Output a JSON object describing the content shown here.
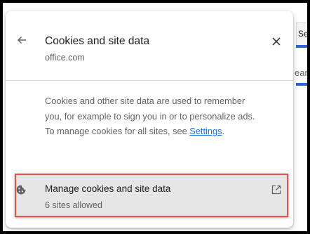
{
  "background": {
    "tab_text": "Se",
    "page_text": "ear",
    "accent_color": "#2b63d9"
  },
  "popup": {
    "back_icon": "arrow-back-icon",
    "title": "Cookies and site data",
    "subtitle": "office.com",
    "close_icon": "close-icon",
    "description_text": "Cookies and other site data are used to remember you, for example to sign you in or to personalize ads. To manage cookies for all sites, see ",
    "settings_link": "Settings",
    "description_end": ".",
    "manage_row": {
      "icon": "cookie-icon",
      "title": "Manage cookies and site data",
      "subtitle": "6 sites allowed",
      "action_icon": "external-link-icon",
      "highlight_color": "#e0544b"
    }
  }
}
